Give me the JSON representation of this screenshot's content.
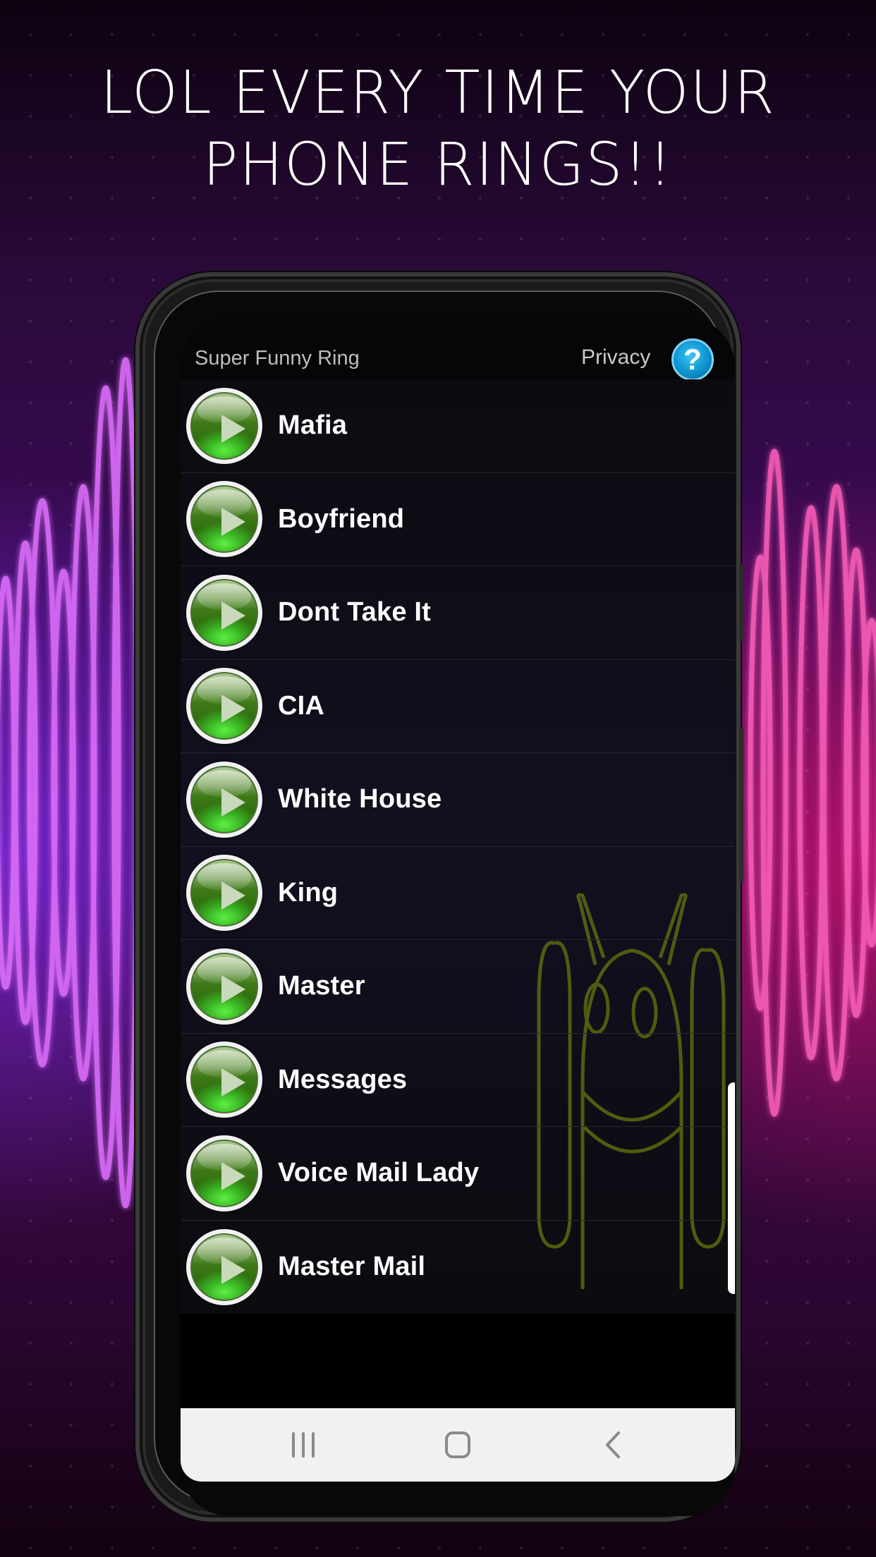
{
  "promo": {
    "headline_line1": "LOL EVERY TIME YOUR",
    "headline_line2": "PHONE RINGS!!"
  },
  "app": {
    "title": "Super Funny Ring",
    "privacy_label": "Privacy",
    "help_icon": "question-mark-icon",
    "help_glyph": "?"
  },
  "ringtones": [
    {
      "label": "Mafia",
      "icon": "play-icon"
    },
    {
      "label": "Boyfriend",
      "icon": "play-icon"
    },
    {
      "label": "Dont Take It",
      "icon": "play-icon"
    },
    {
      "label": "CIA",
      "icon": "play-icon"
    },
    {
      "label": "White House",
      "icon": "play-icon"
    },
    {
      "label": "King",
      "icon": "play-icon"
    },
    {
      "label": "Master",
      "icon": "play-icon"
    },
    {
      "label": "Messages",
      "icon": "play-icon"
    },
    {
      "label": "Voice Mail Lady",
      "icon": "play-icon"
    },
    {
      "label": "Master Mail",
      "icon": "play-icon"
    }
  ],
  "navbar": {
    "recent_icon": "recent-apps-icon",
    "home_icon": "home-icon",
    "back_icon": "back-chevron-icon"
  },
  "colors": {
    "accent_green": "#3cb826",
    "help_blue": "#0e93cf",
    "wave_left": "#c35cf0",
    "wave_right": "#f04ca8",
    "mascot_outline": "#5a6a10"
  }
}
